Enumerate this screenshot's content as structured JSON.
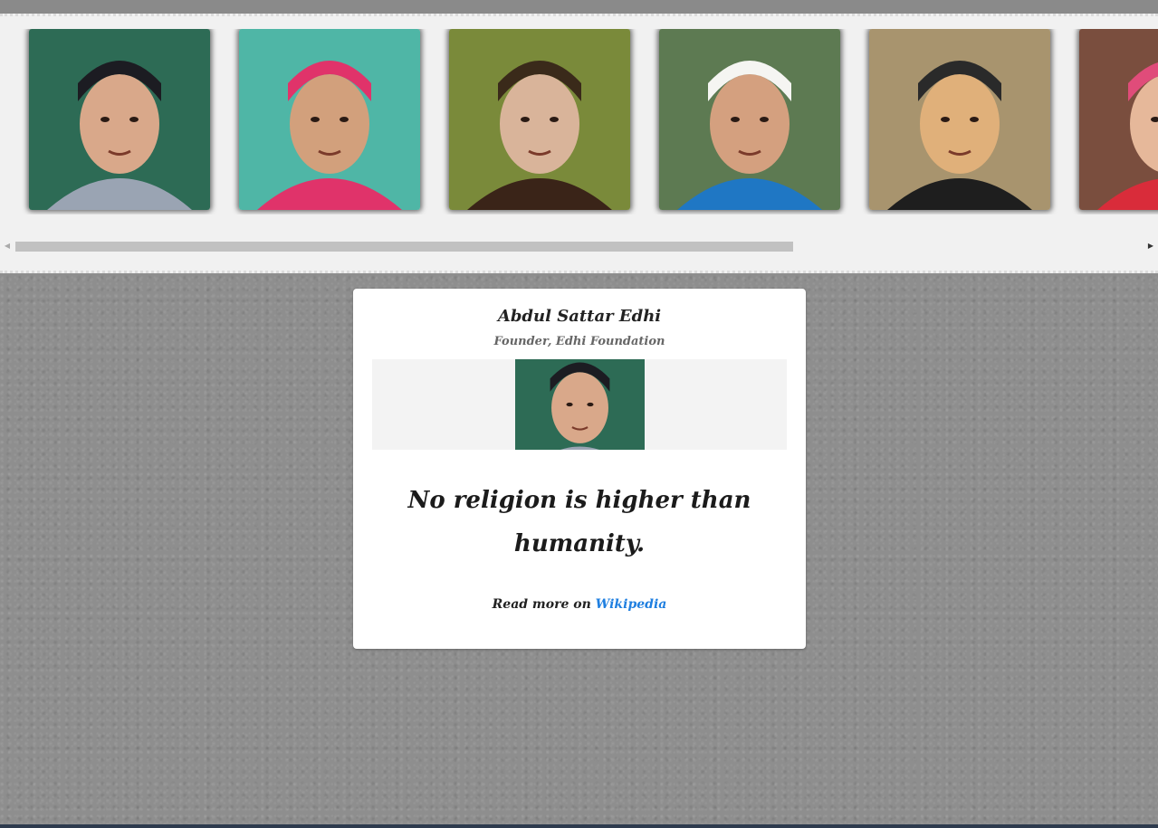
{
  "gallery": {
    "people": [
      {
        "icon": "portrait-bearded-man-cap-icon",
        "bg": "#2d6b55",
        "skin": "#d9a88a",
        "hat": "#1c1c22",
        "hair": "#ffffff",
        "cloth": "#9aa4b3"
      },
      {
        "icon": "portrait-woman-pink-scarf-icon",
        "bg": "#4fb6a6",
        "skin": "#d2a07c",
        "hat": "#e0336a",
        "hair": "#1a1210",
        "cloth": "#e0336a"
      },
      {
        "icon": "portrait-man-karakul-cap-icon",
        "bg": "#7a8a3a",
        "skin": "#d9b49a",
        "hat": "#3a2a1a",
        "hair": "#dcdcdc",
        "cloth": "#3a2418"
      },
      {
        "icon": "portrait-woman-white-scarf-icon",
        "bg": "#5d7a52",
        "skin": "#d4a07f",
        "hat": "#f5f5f2",
        "hair": "#2a1a14",
        "cloth": "#1f77c4"
      },
      {
        "icon": "portrait-man-mustache-icon",
        "bg": "#a8946e",
        "skin": "#e0b07a",
        "hat": "#2a2a2a",
        "hair": "#2a2a2a",
        "cloth": "#1e1e1e"
      },
      {
        "icon": "portrait-girl-pink-headband-icon",
        "bg": "#7a4e3e",
        "skin": "#e6b89a",
        "hat": "#e04c7a",
        "hair": "#3a2418",
        "cloth": "#d92c3a"
      }
    ]
  },
  "card": {
    "name": "Abdul Sattar Edhi",
    "title": "Founder, Edhi Foundation",
    "quote": "No religion is higher than humanity.",
    "read_more_prefix": "Read more on",
    "read_more_link": "Wikipedia",
    "portrait_icon": "portrait-bearded-man-cap-icon"
  },
  "colors": {
    "link": "#1f7fe0",
    "card_bg": "#ffffff",
    "page_bg": "#8e8e8e"
  }
}
